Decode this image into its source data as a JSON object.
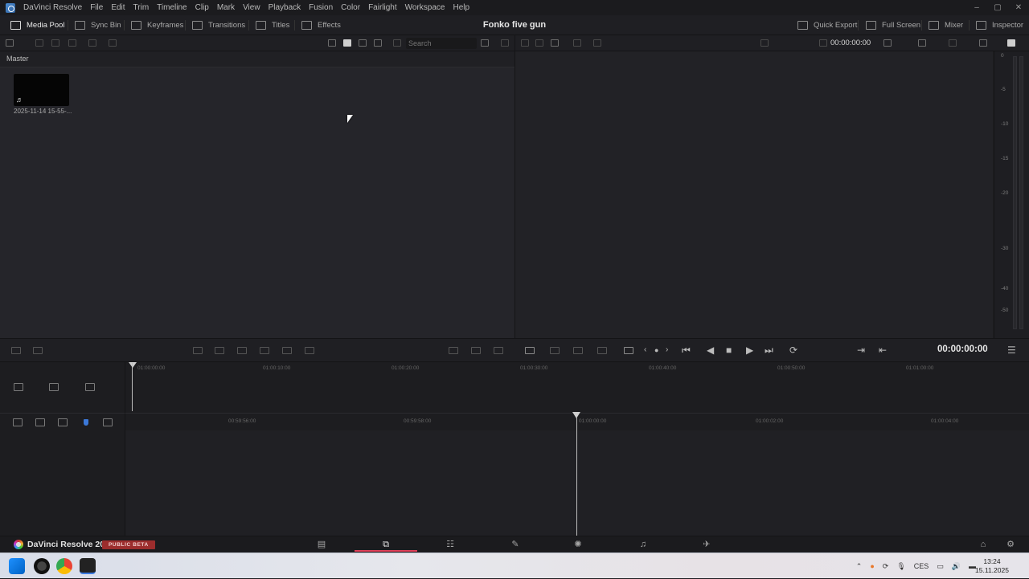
{
  "menubar": {
    "app_name": "DaVinci Resolve",
    "items": [
      "File",
      "Edit",
      "Trim",
      "Timeline",
      "Clip",
      "Mark",
      "View",
      "Playback",
      "Fusion",
      "Color",
      "Fairlight",
      "Workspace",
      "Help"
    ],
    "window_controls": [
      "–",
      "▢",
      "✕"
    ]
  },
  "toolbar": {
    "media_pool": "Media Pool",
    "sync_bin": "Sync Bin",
    "keyframes": "Keyframes",
    "transitions": "Transitions",
    "titles": "Titles",
    "effects": "Effects",
    "project_title": "Fonko five gun",
    "quick_export": "Quick Export",
    "full_screen": "Full Screen",
    "mixer": "Mixer",
    "inspector": "Inspector"
  },
  "subbar": {
    "search_placeholder": "Search",
    "viewer_timecode": "00:00:00:00"
  },
  "mediapool": {
    "bin_label": "Master",
    "clip": {
      "name": "2025-11-14 15-55-...",
      "type_icon": "♬"
    }
  },
  "meter": {
    "labels": [
      "0",
      "-5",
      "-10",
      "-15",
      "-20",
      "-30",
      "-40",
      "-50"
    ]
  },
  "transport": {
    "timecode": "00:00:00:00"
  },
  "timeline": {
    "upper_ticks": [
      "01:00:00:00",
      "01:00:10:00",
      "01:00:20:00",
      "01:00:30:00",
      "01:00:40:00",
      "01:00:50:00",
      "01:01:00:00"
    ],
    "lower_ticks": [
      "00:59:56:00",
      "00:59:58:00",
      "01:00:00:00",
      "01:00:02:00",
      "01:00:04:00"
    ]
  },
  "pagebar": {
    "brand": "DaVinci Resolve 20",
    "badge": "PUBLIC BETA",
    "active_page": "cut",
    "accent_color": "#e0415a"
  },
  "taskbar": {
    "language": "CES",
    "time": "13:24",
    "date": "15.11.2025"
  }
}
